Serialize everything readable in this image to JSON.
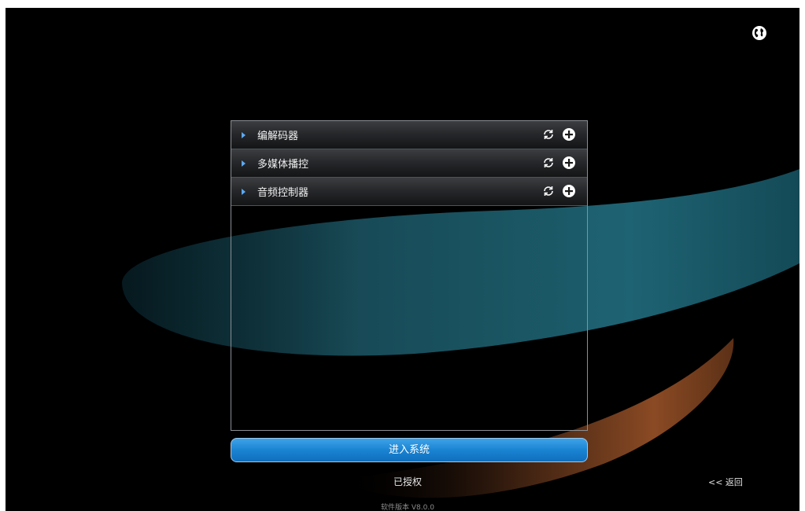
{
  "header": {
    "language_icon": "globe-icon"
  },
  "devices": {
    "items": [
      {
        "label": "编解码器"
      },
      {
        "label": "多媒体播控"
      },
      {
        "label": "音频控制器"
      }
    ],
    "refresh_icon": "refresh-icon",
    "add_icon": "plus-circle-icon"
  },
  "actions": {
    "enter_label": "进入系统",
    "status": "已授权",
    "back_label": "<< 返回"
  },
  "footer": {
    "version": "软件版本 V8.0.0"
  },
  "colors": {
    "background": "#000000",
    "primary_button": "#1a83d2",
    "arrow": "#5aa9ff",
    "teal_wave": "#1f5f6c",
    "orange_wave": "#8a4a24"
  }
}
